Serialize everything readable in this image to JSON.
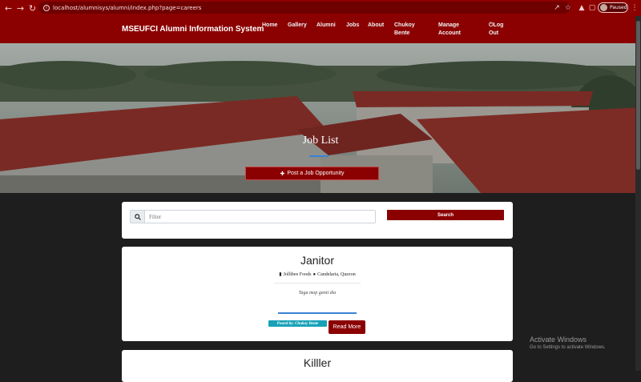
{
  "browser": {
    "url": "localhost/alumnisys/alumni/index.php?page=careers",
    "profile_label": "Paused"
  },
  "navbar": {
    "brand": "MSEUFCI Alumni Information System",
    "items": [
      "Home",
      "Gallery",
      "Alumni",
      "Jobs",
      "About",
      "Chukoy Bente",
      "Manage Account",
      "Log Out"
    ]
  },
  "hero": {
    "title": "Job List",
    "post_button": "Post a Job Opportunity"
  },
  "filter": {
    "placeholder": "Filter",
    "search_label": "Search"
  },
  "jobs": [
    {
      "title": "Janitor",
      "company": "Jollibee Foods",
      "location": "Candelaria, Quezon",
      "description": "Taga mop ganit dia",
      "posted_by": "Posted by: Chukoy Bente",
      "read_more": "Read More"
    },
    {
      "title": "Killler"
    }
  ],
  "watermark": {
    "line1": "Activate Windows",
    "line2": "Go to Settings to activate Windows."
  },
  "colors": {
    "brand": "#8b0000",
    "accent_blue": "#3a82d6",
    "badge": "#17a2b8"
  }
}
